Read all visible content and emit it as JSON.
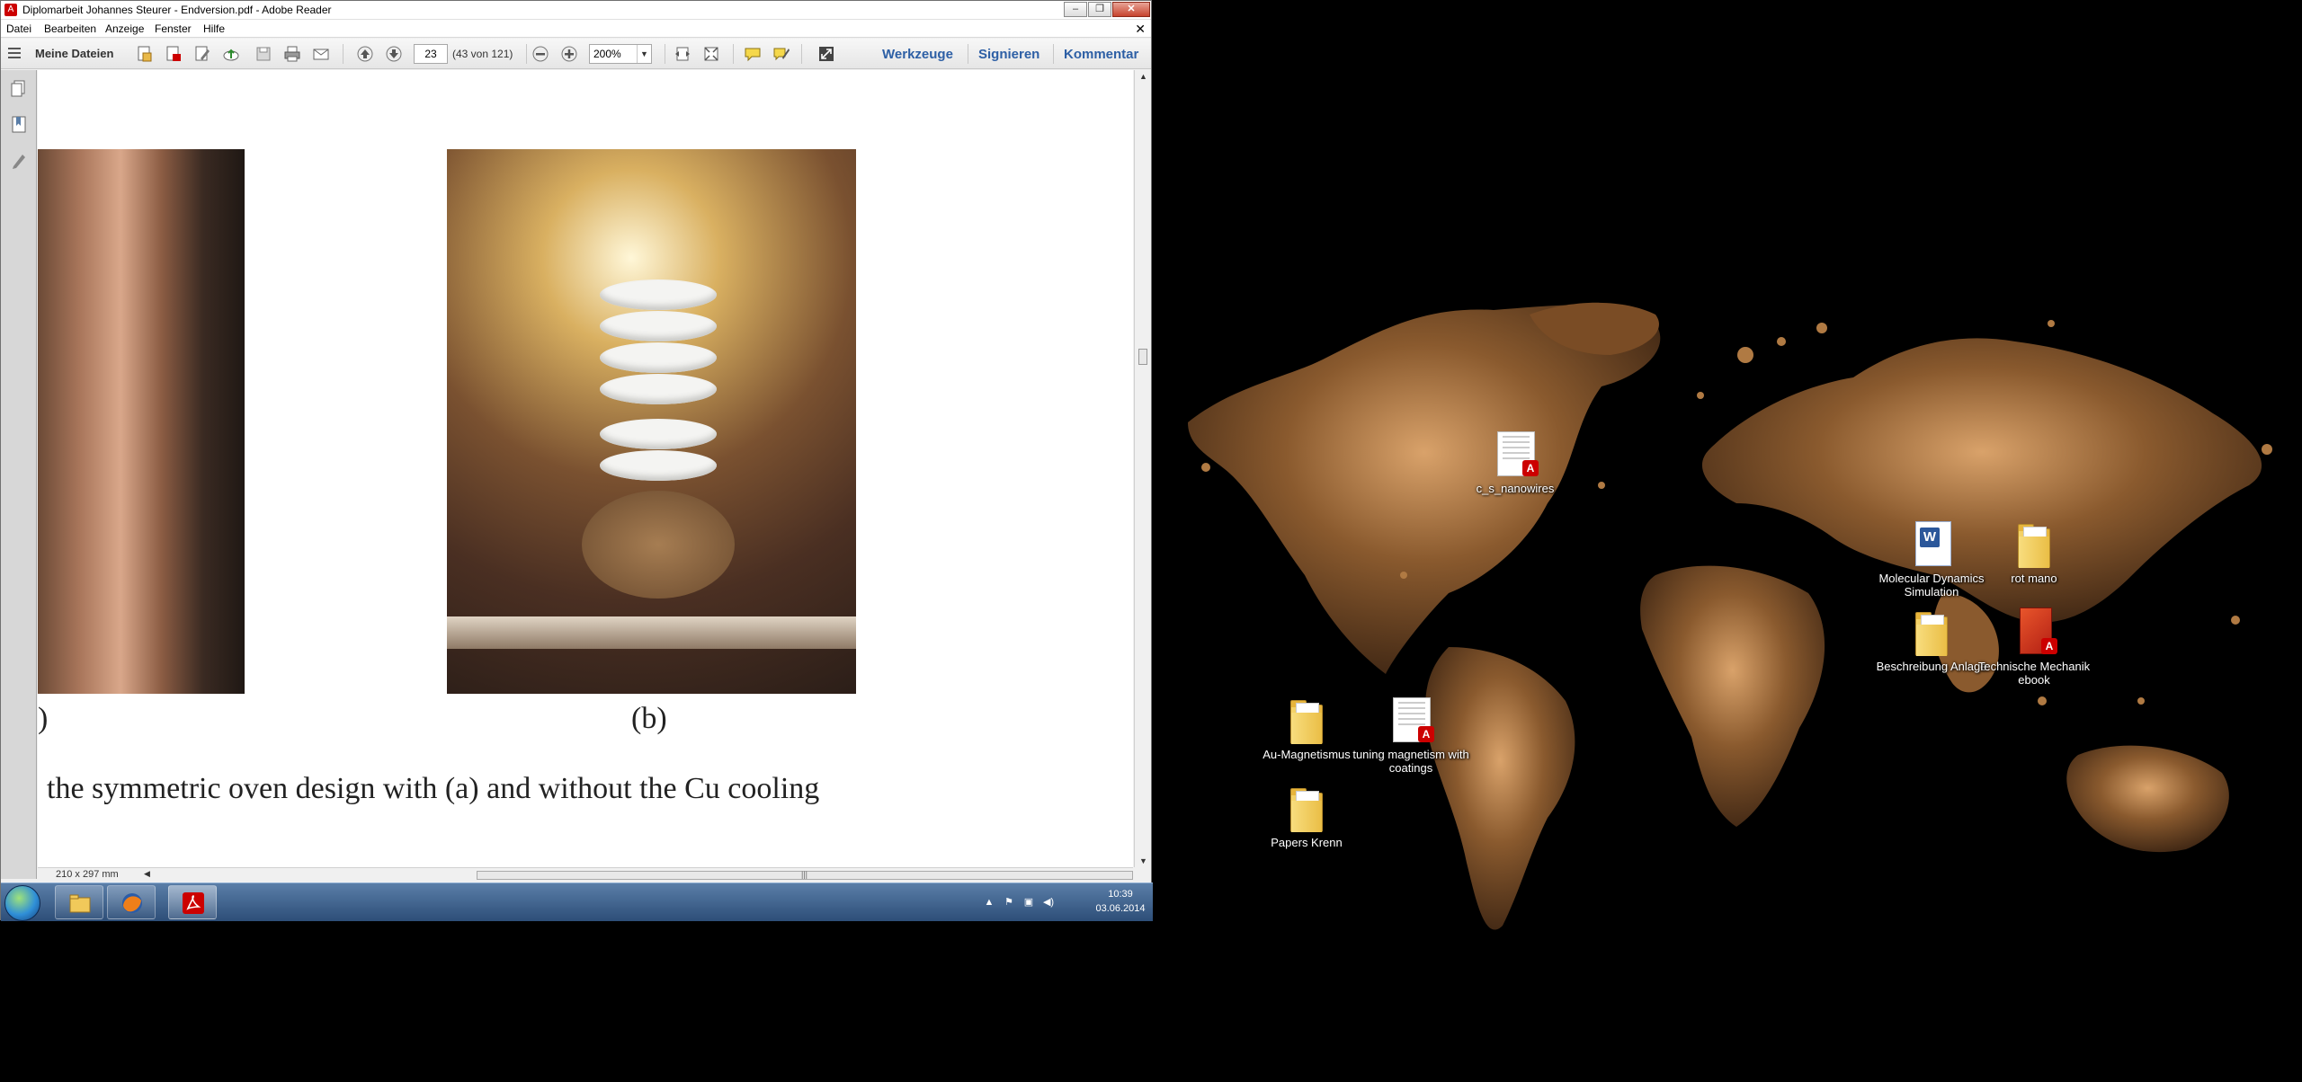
{
  "window": {
    "title": "Diplomarbeit Johannes Steurer - Endversion.pdf - Adobe Reader",
    "min_label": "–",
    "max_label": "❐",
    "close_label": "✕"
  },
  "menu": {
    "items": [
      "Datei",
      "Bearbeiten",
      "Anzeige",
      "Fenster",
      "Hilfe"
    ],
    "doc_close": "✕"
  },
  "toolbar": {
    "my_files": "Meine Dateien",
    "page_current": "23",
    "page_count": "(43 von 121)",
    "zoom": "200%",
    "tools": "Werkzeuge",
    "sign": "Signieren",
    "comment": "Kommentar"
  },
  "document": {
    "caption_a": ")",
    "caption_b": "(b)",
    "figure_caption": "the symmetric oven design with (a) and without the Cu cooling"
  },
  "status": {
    "page_size": "210 x 297 mm"
  },
  "taskbar": {
    "time": "10:39",
    "date": "03.06.2014"
  },
  "desktop": {
    "icons": [
      {
        "label": "c_s_nanowires",
        "type": "pdf"
      },
      {
        "label": "Molecular Dynamics Simulation",
        "type": "word"
      },
      {
        "label": "rot mano",
        "type": "folder"
      },
      {
        "label": "Beschreibung Anlage",
        "type": "folder"
      },
      {
        "label": "Technische Mechanik ebook",
        "type": "pdf-book"
      },
      {
        "label": "Au-Magnetismus",
        "type": "folder"
      },
      {
        "label": "tuning magnetism with coatings",
        "type": "pdf"
      },
      {
        "label": "Papers Krenn",
        "type": "folder"
      }
    ]
  },
  "colors": {
    "accent_link": "#2d5fa5",
    "acrobat_red": "#cc0000",
    "wallpaper_splash": "#a4713d"
  }
}
